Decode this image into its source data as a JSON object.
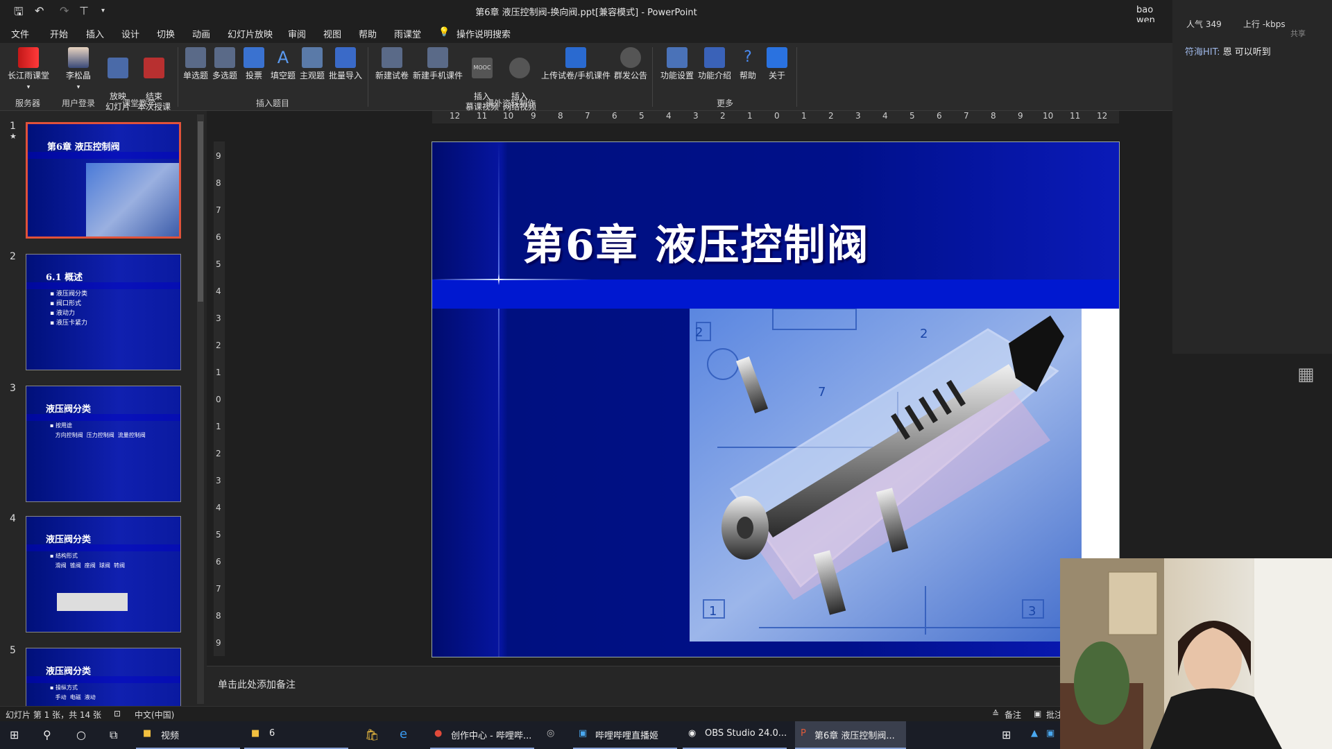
{
  "window": {
    "title": "第6章  液压控制阀-换向阀.ppt[兼容模式]  -  PowerPoint",
    "user": "bao wen"
  },
  "menu": {
    "tabs": [
      "文件",
      "开始",
      "插入",
      "设计",
      "切换",
      "动画",
      "幻灯片放映",
      "审阅",
      "视图",
      "帮助",
      "雨课堂"
    ],
    "search": "操作说明搜索"
  },
  "ribbon": {
    "buttons": [
      "长江雨课堂",
      "李松晶",
      "放映\n幻灯片",
      "结束\n本次授课",
      "单选题",
      "多选题",
      "投票",
      "填空题",
      "主观题",
      "批量导入",
      "新建试卷",
      "新建手机课件",
      "插入\n慕课视频",
      "插入\n网络视频",
      "上传试卷/手机课件",
      "群发公告",
      "功能设置",
      "功能介绍",
      "帮助",
      "关于"
    ],
    "groups": [
      "服务器",
      "用户登录",
      "课堂教学",
      "插入题目",
      "课外资料制作",
      "更多"
    ],
    "mooc_icon_text": "MOOC"
  },
  "thumbnails": [
    {
      "num": "1",
      "title": "第6章  液压控制阀",
      "bullets": [],
      "marker": "★"
    },
    {
      "num": "2",
      "title": "6.1  概述",
      "bullets": [
        "▪ 液压阀分类",
        "▪ 阀口形式",
        "▪ 液动力",
        "▪ 液压卡紧力"
      ]
    },
    {
      "num": "3",
      "title": "液压阀分类",
      "bullets": [
        "▪ 按用途",
        "   方向控制阀  压力控制阀  流量控制阀"
      ]
    },
    {
      "num": "4",
      "title": "液压阀分类",
      "bullets": [
        "▪ 结构形式",
        "   滑阀  锥阀  座阀  球阀  转阀"
      ]
    },
    {
      "num": "5",
      "title": "液压阀分类",
      "bullets": [
        "▪ 操纵方式",
        "   手动  电磁  液动"
      ]
    }
  ],
  "ruler": {
    "h": [
      "12",
      "11",
      "10",
      "9",
      "8",
      "7",
      "6",
      "5",
      "4",
      "3",
      "2",
      "1",
      "0",
      "1",
      "2",
      "3",
      "4",
      "5",
      "6",
      "7",
      "8",
      "9",
      "10",
      "11",
      "12"
    ],
    "v": [
      "9",
      "8",
      "7",
      "6",
      "5",
      "4",
      "3",
      "2",
      "1",
      "0",
      "1",
      "2",
      "3",
      "4",
      "5",
      "6",
      "7",
      "8",
      "9"
    ]
  },
  "slide": {
    "title": "第6章  液压控制阀",
    "photo_labels": [
      "2",
      "2",
      "1",
      "3",
      "7"
    ]
  },
  "notes": {
    "placeholder": "单击此处添加备注"
  },
  "status": {
    "slide_info": "幻灯片 第 1 张，共 14 张",
    "language": "中文(中国)",
    "notes_btn": "备注",
    "comments_btn": "批注"
  },
  "chat": {
    "popularity": "人气  349",
    "upload": "上行  -kbps",
    "share": "共享",
    "message_nick": "符海HIT:",
    "message_text": " 恩 可以听到"
  },
  "taskbar": {
    "items": [
      "视频",
      "6",
      "创作中心 - 哔哩哔...",
      "哔哩哔哩直播姬",
      "OBS Studio 24.0...",
      "第6章  液压控制阀..."
    ]
  }
}
